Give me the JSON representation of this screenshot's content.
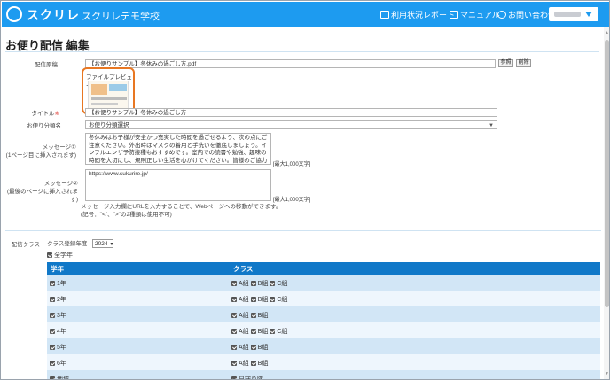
{
  "header": {
    "logo_text": "スクリレ",
    "school_name": "スクリレデモ学校",
    "nav": [
      {
        "label": "利用状況レポート",
        "icon": "report-icon"
      },
      {
        "label": "マニュアル",
        "icon": "book-icon"
      },
      {
        "label": "お問い合わせ",
        "icon": "help-icon"
      }
    ]
  },
  "page": {
    "title": "お便り配信 編集"
  },
  "form": {
    "file_label": "配信原稿",
    "file_value": "【お便りサンプル】冬休みの過ごし方.pdf",
    "browse_label": "参照",
    "delete_label": "削除",
    "preview_title": "ファイルプレビュー",
    "title_label": "タイトル",
    "required_mark": "※",
    "title_value": "【お便りサンプル】冬休みの過ごし方",
    "category_label": "お便り分類名",
    "category_value": "お便り分類選択",
    "msg1_label_1": "メッセージ①",
    "msg1_label_2": "(1ページ目に挿入されます)",
    "msg1_value": "冬休みはお子様が安全かつ充実した時間を過ごせるよう、次の点にご注意ください。外出時はマスクの着用と手洗いを徹底しましょう。インフルエンザ予防接種もおすすめです。室内での読書や勉強、趣味の時間を大切にし、規則正しい生活を心がけてください。皆様のご協力をお願い申し上げます。",
    "msg1_limit": "[最大1,000文字]",
    "msg2_label_1": "メッセージ②",
    "msg2_label_2": "(最後のページに挿入されます)",
    "msg2_value": "https://www.sukurire.jp/",
    "msg2_limit": "[最大1,000文字]",
    "note_1": "メッセージ入力欄にURLを入力することで、Webページへの移動ができます。",
    "note_2": "(記号：\"<\"、\">\"の2種類は使用不可)"
  },
  "classes": {
    "label": "配信クラス",
    "year_label": "クラス登録年度",
    "year_value": "2024",
    "all_label": "全学年",
    "col_grade": "学年",
    "col_class": "クラス",
    "rows": [
      {
        "grade": "1年",
        "classes": [
          "A組",
          "B組",
          "C組"
        ]
      },
      {
        "grade": "2年",
        "classes": [
          "A組",
          "B組",
          "C組"
        ]
      },
      {
        "grade": "3年",
        "classes": [
          "A組",
          "B組"
        ]
      },
      {
        "grade": "4年",
        "classes": [
          "A組",
          "B組",
          "C組"
        ]
      },
      {
        "grade": "5年",
        "classes": [
          "A組",
          "B組"
        ]
      },
      {
        "grade": "6年",
        "classes": [
          "A組",
          "B組"
        ]
      },
      {
        "grade": "地域",
        "classes": [
          "見守り隊"
        ]
      }
    ]
  },
  "colors": {
    "header": "#1d9bf0",
    "table_header": "#1078c8",
    "highlight": "#e87722"
  }
}
